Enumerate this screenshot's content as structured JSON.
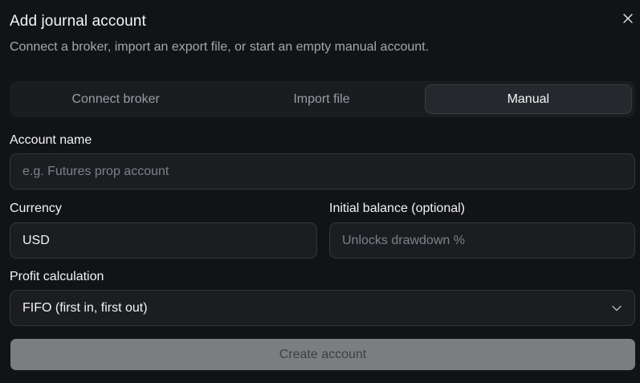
{
  "dialog": {
    "title": "Add journal account",
    "subtitle": "Connect a broker, import an export file, or start an empty manual account.",
    "close_icon": "close-icon"
  },
  "tabs": [
    {
      "label": "Connect broker",
      "active": false
    },
    {
      "label": "Import file",
      "active": false
    },
    {
      "label": "Manual",
      "active": true
    }
  ],
  "form": {
    "account_name": {
      "label": "Account name",
      "value": "",
      "placeholder": "e.g. Futures prop account"
    },
    "currency": {
      "label": "Currency",
      "value": "USD",
      "placeholder": ""
    },
    "initial_balance": {
      "label": "Initial balance (optional)",
      "value": "",
      "placeholder": "Unlocks drawdown %"
    },
    "profit_calculation": {
      "label": "Profit calculation",
      "selected": "FIFO (first in, first out)",
      "icon": "chevron-down-icon"
    }
  },
  "actions": {
    "create_label": "Create account"
  },
  "colors": {
    "background": "#121316",
    "field_bg": "#1c1d21",
    "field_border": "#34363b",
    "button_disabled_bg": "#7c7d80",
    "button_disabled_text": "#3e3f43"
  }
}
